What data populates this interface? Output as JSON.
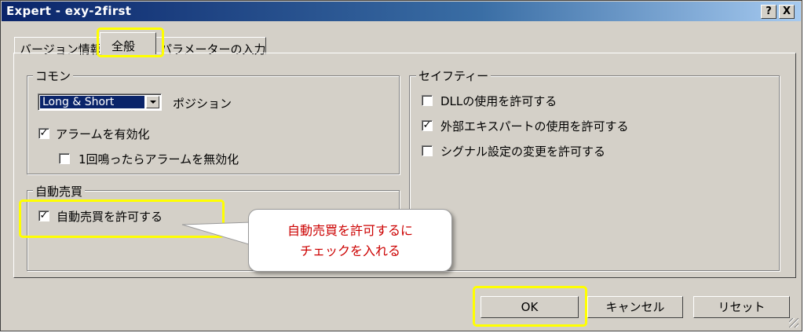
{
  "window": {
    "title": "Expert - exy-2first",
    "help_label": "?",
    "close_label": "X"
  },
  "tabs": [
    {
      "label": "バージョン情報"
    },
    {
      "label": "全般"
    },
    {
      "label": "パラメーターの入力"
    }
  ],
  "common": {
    "title": "コモン",
    "position_value": "Long & Short",
    "position_label": "ポジション",
    "alert_label": "アラームを有効化",
    "alert_checked": true,
    "disable_alert_label": "1回鳴ったらアラームを無効化",
    "disable_alert_checked": false
  },
  "auto_trade": {
    "title": "自動売買",
    "allow_label": "自動売買を許可する",
    "allow_checked": true
  },
  "safety": {
    "title": "セイフティー",
    "items": [
      {
        "label": "DLLの使用を許可する",
        "checked": false
      },
      {
        "label": "外部エキスパートの使用を許可する",
        "checked": true
      },
      {
        "label": "シグナル設定の変更を許可する",
        "checked": false
      }
    ]
  },
  "buttons": {
    "ok": "OK",
    "cancel": "キャンセル",
    "reset": "リセット"
  },
  "callout": {
    "line1": "自動売買を許可するに",
    "line2": "チェックを入れる"
  },
  "colors": {
    "highlight": "#ffff00",
    "callout_text": "#cc0000",
    "title_bar": "#0a246a"
  }
}
